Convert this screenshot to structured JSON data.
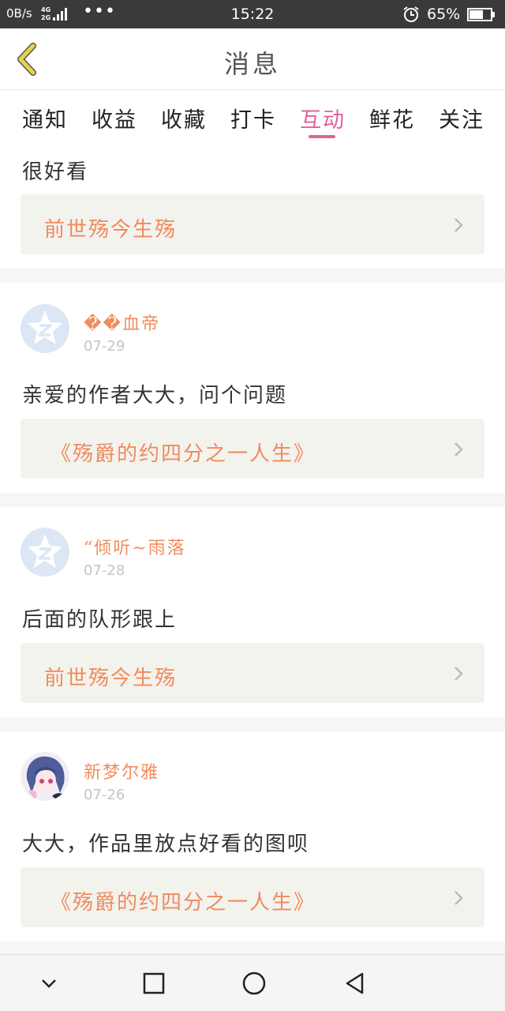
{
  "status_bar": {
    "net_speed": "0B/s",
    "net_type_top": "4G",
    "net_type_bottom": "2G",
    "more": "•••",
    "time": "15:22",
    "battery_pct": "65%"
  },
  "header": {
    "back_icon": "chevron-left-icon",
    "title": "消息"
  },
  "tabs": [
    {
      "label": "通知"
    },
    {
      "label": "收益"
    },
    {
      "label": "收藏"
    },
    {
      "label": "打卡"
    },
    {
      "label": "互动",
      "active": true
    },
    {
      "label": "鲜花"
    },
    {
      "label": "关注"
    }
  ],
  "feed": [
    {
      "comment": "很好看",
      "link": "前世殇今生殇"
    },
    {
      "user": "��血帝",
      "date": "07-29",
      "comment": "亲爱的作者大大，问个问题",
      "link": "《殇爵的约四分之一人生》"
    },
    {
      "user": "“倾听~雨落",
      "date": "07-28",
      "comment": "后面的队形跟上",
      "link": "前世殇今生殇"
    },
    {
      "user": "新梦尔雅",
      "date": "07-26",
      "comment": "大大，作品里放点好看的图呗",
      "link": "《殇爵的约四分之一人生》"
    }
  ],
  "nav": {
    "down_icon": "chevron-down-icon",
    "recent_icon": "square-icon",
    "home_icon": "circle-icon",
    "back_icon": "triangle-back-icon"
  },
  "colors": {
    "accent": "#e0609a",
    "username": "#ef8e5e",
    "link": "#f08a5d",
    "back_arrow": "#e8d24a"
  }
}
